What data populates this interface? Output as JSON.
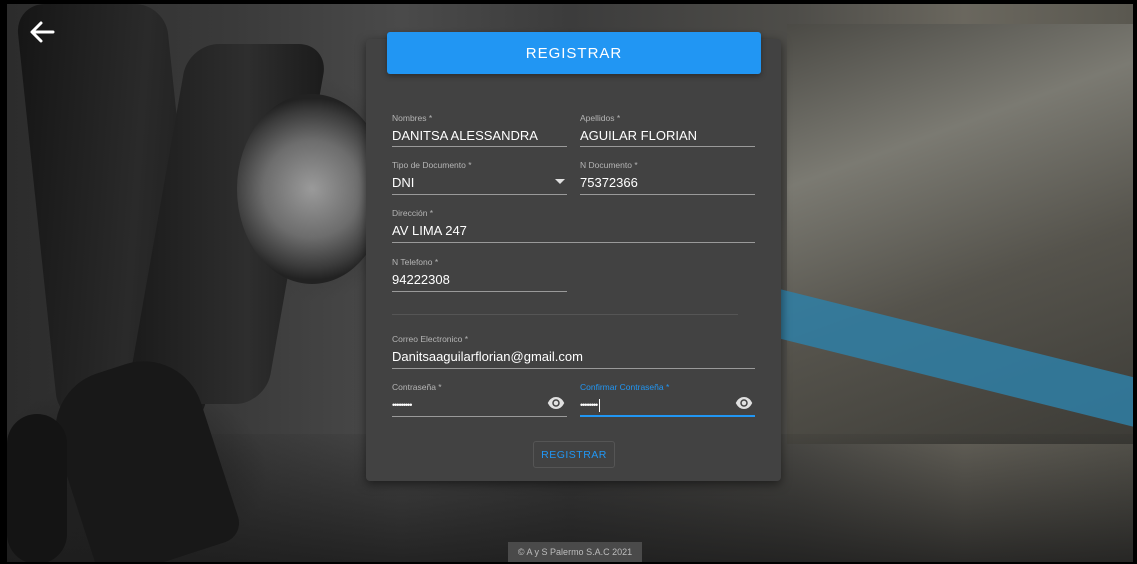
{
  "header": {
    "title": "REGISTRAR"
  },
  "form": {
    "nombres": {
      "label": "Nombres *",
      "value": "DANITSA ALESSANDRA"
    },
    "apellidos": {
      "label": "Apellidos *",
      "value": "AGUILAR FLORIAN"
    },
    "tipo_documento": {
      "label": "Tipo de Documento *",
      "value": "DNI"
    },
    "n_documento": {
      "label": "N Documento *",
      "value": "75372366"
    },
    "direccion": {
      "label": "Dirección *",
      "value": "AV LIMA 247"
    },
    "telefono": {
      "label": "N Telefono *",
      "value": "94222308"
    },
    "correo": {
      "label": "Correo Electronico *",
      "value": "Danitsaaguilarflorian@gmail.com"
    },
    "contrasena": {
      "label": "Contraseña *",
      "value": "•••••••••"
    },
    "confirmar": {
      "label": "Confirmar Contraseña *",
      "value": "••••••••"
    },
    "submit_label": "REGISTRAR"
  },
  "footer": {
    "text": "© A y S Palermo S.A.C 2021"
  },
  "icons": {
    "back": "arrow-left-icon",
    "dropdown": "caret-down-icon",
    "eye": "eye-icon"
  },
  "colors": {
    "accent": "#2196f3",
    "card": "#424242"
  }
}
